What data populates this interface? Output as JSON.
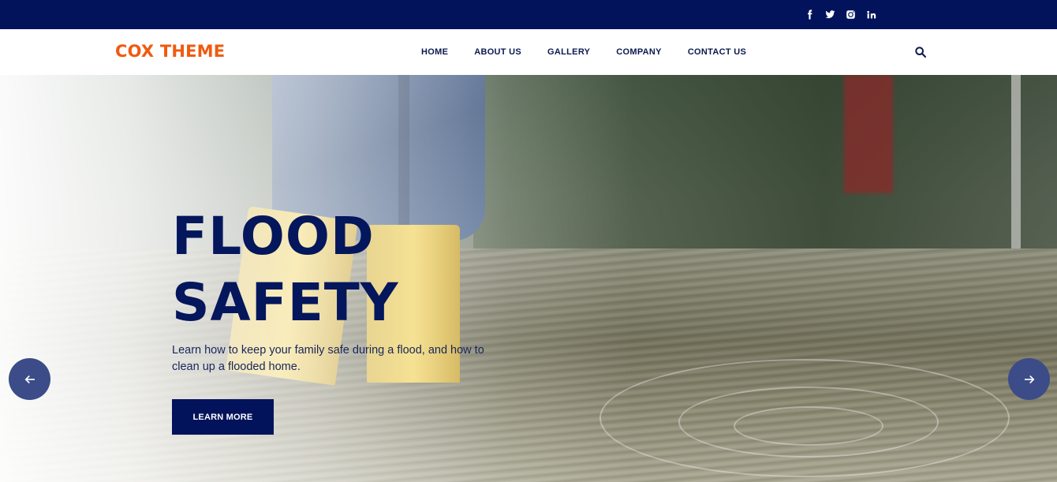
{
  "brand": {
    "name": "COX THEME",
    "color": "#f05a0f"
  },
  "topbar": {
    "background": "#03135b",
    "socials": [
      {
        "name": "facebook",
        "icon": "facebook-icon"
      },
      {
        "name": "twitter",
        "icon": "twitter-icon"
      },
      {
        "name": "instagram",
        "icon": "instagram-icon"
      },
      {
        "name": "linkedin",
        "icon": "linkedin-icon"
      }
    ]
  },
  "nav": {
    "items": [
      {
        "label": "HOME"
      },
      {
        "label": "ABOUT US"
      },
      {
        "label": "GALLERY"
      },
      {
        "label": "COMPANY"
      },
      {
        "label": "CONTACT US"
      }
    ],
    "search_icon": "search-icon"
  },
  "hero": {
    "title_line1": "FLOOD",
    "title_line2": "SAFETY",
    "description": "Learn how to keep your family safe during a flood, and how to clean up a flooded home.",
    "cta_label": "LEARN MORE",
    "prev_icon": "arrow-left-icon",
    "next_icon": "arrow-right-icon",
    "accent": "#03135b"
  }
}
